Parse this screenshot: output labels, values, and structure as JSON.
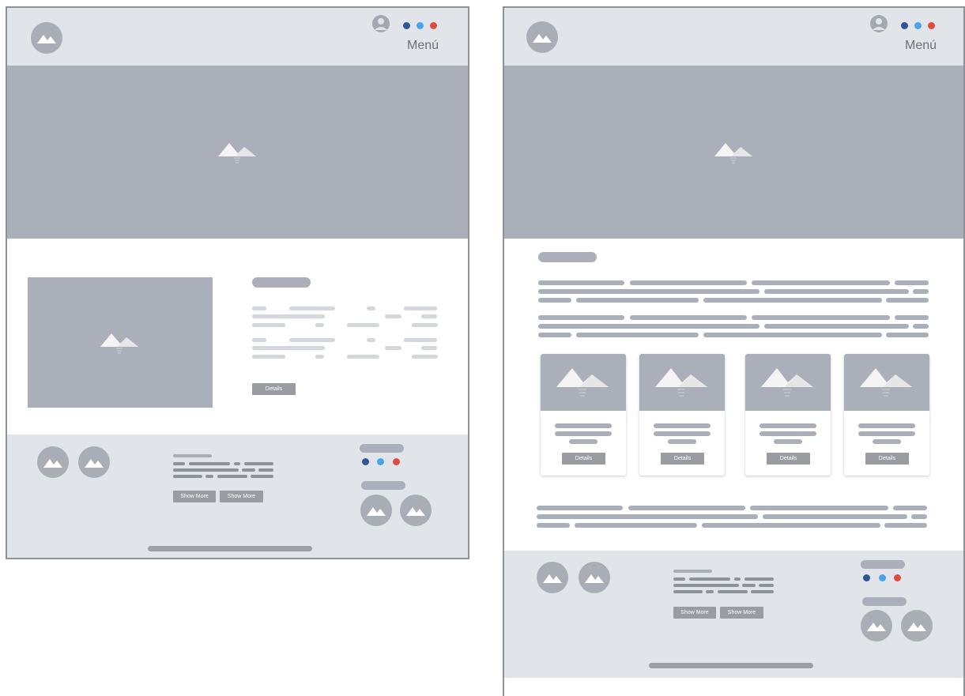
{
  "header": {
    "menu_label": "Menú",
    "dots": [
      "#2f5597",
      "#4aa2e8",
      "#e04a3f"
    ]
  },
  "content": {
    "details_label": "Details",
    "show_more_label": "Show More"
  },
  "colors": {
    "header_bg": "#e1e5ea",
    "hero_bg": "#aaafb9",
    "placeholder": "#a9adb6"
  },
  "icons": [
    "image-icon",
    "user-icon"
  ]
}
